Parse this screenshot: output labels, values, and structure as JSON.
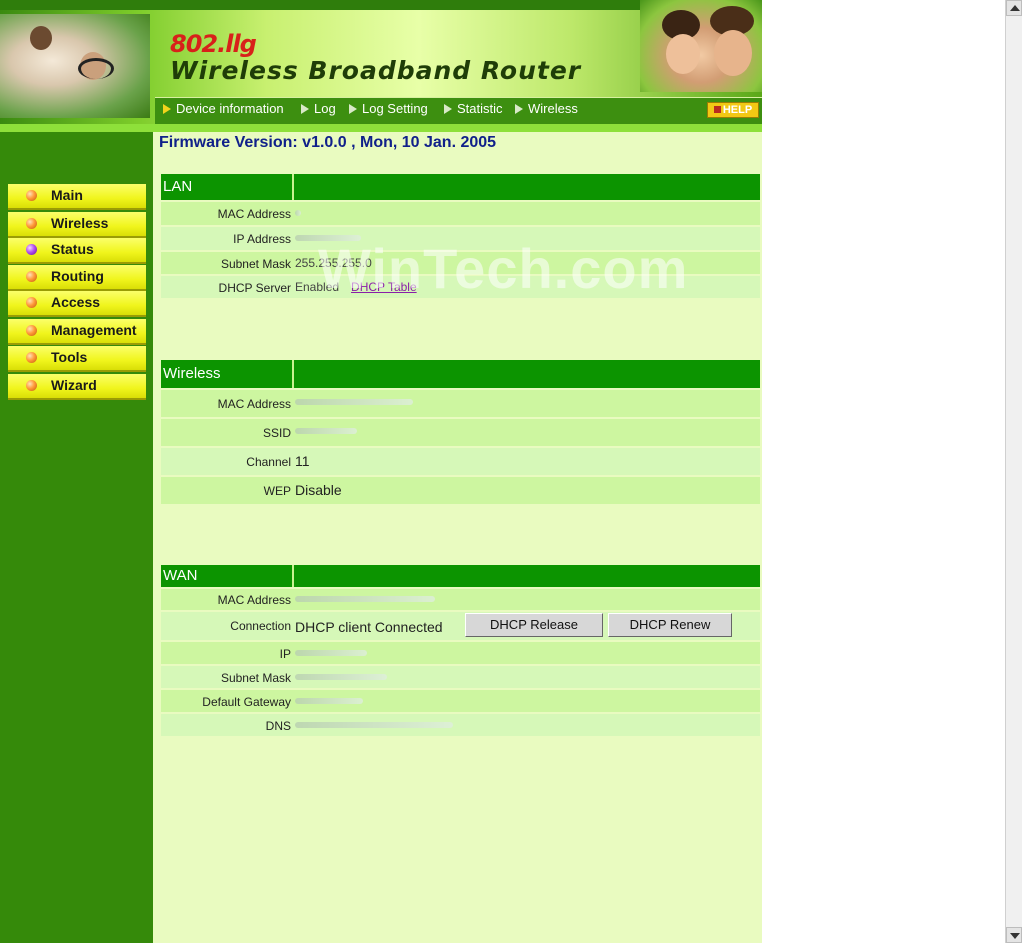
{
  "header": {
    "model": "802.llg",
    "title": "Wireless Broadband Router",
    "nav": [
      "Device information",
      "Log",
      "Log Setting",
      "Statistic",
      "Wireless"
    ],
    "help_label": "HELP"
  },
  "sidebar": {
    "items": [
      {
        "label": "Main"
      },
      {
        "label": "Wireless"
      },
      {
        "label": "Status",
        "active": true
      },
      {
        "label": "Routing"
      },
      {
        "label": "Access"
      },
      {
        "label": "Management"
      },
      {
        "label": "Tools"
      },
      {
        "label": "Wizard"
      }
    ]
  },
  "firmware": "Firmware Version: v1.0.0 , Mon, 10 Jan. 2005",
  "lan": {
    "title": "LAN",
    "mac_label": "MAC Address",
    "ip_label": "IP Address",
    "subnet_label": "Subnet Mask",
    "subnet_value": "255.255.255.0",
    "dhcp_label": "DHCP Server",
    "dhcp_value": "Enabled",
    "dhcp_table_link": "DHCP Table"
  },
  "wireless": {
    "title": "Wireless",
    "mac_label": "MAC Address",
    "ssid_label": "SSID",
    "channel_label": "Channel",
    "channel_value": "11",
    "wep_label": "WEP",
    "wep_value": "Disable"
  },
  "wan": {
    "title": "WAN",
    "mac_label": "MAC Address",
    "connection_label": "Connection",
    "connection_value": "DHCP client Connected",
    "release_button": "DHCP Release",
    "renew_button": "DHCP Renew",
    "ip_label": "IP",
    "subnet_label": "Subnet Mask",
    "gateway_label": "Default Gateway",
    "dns_label": "DNS"
  },
  "watermark": "WinTech.com"
}
